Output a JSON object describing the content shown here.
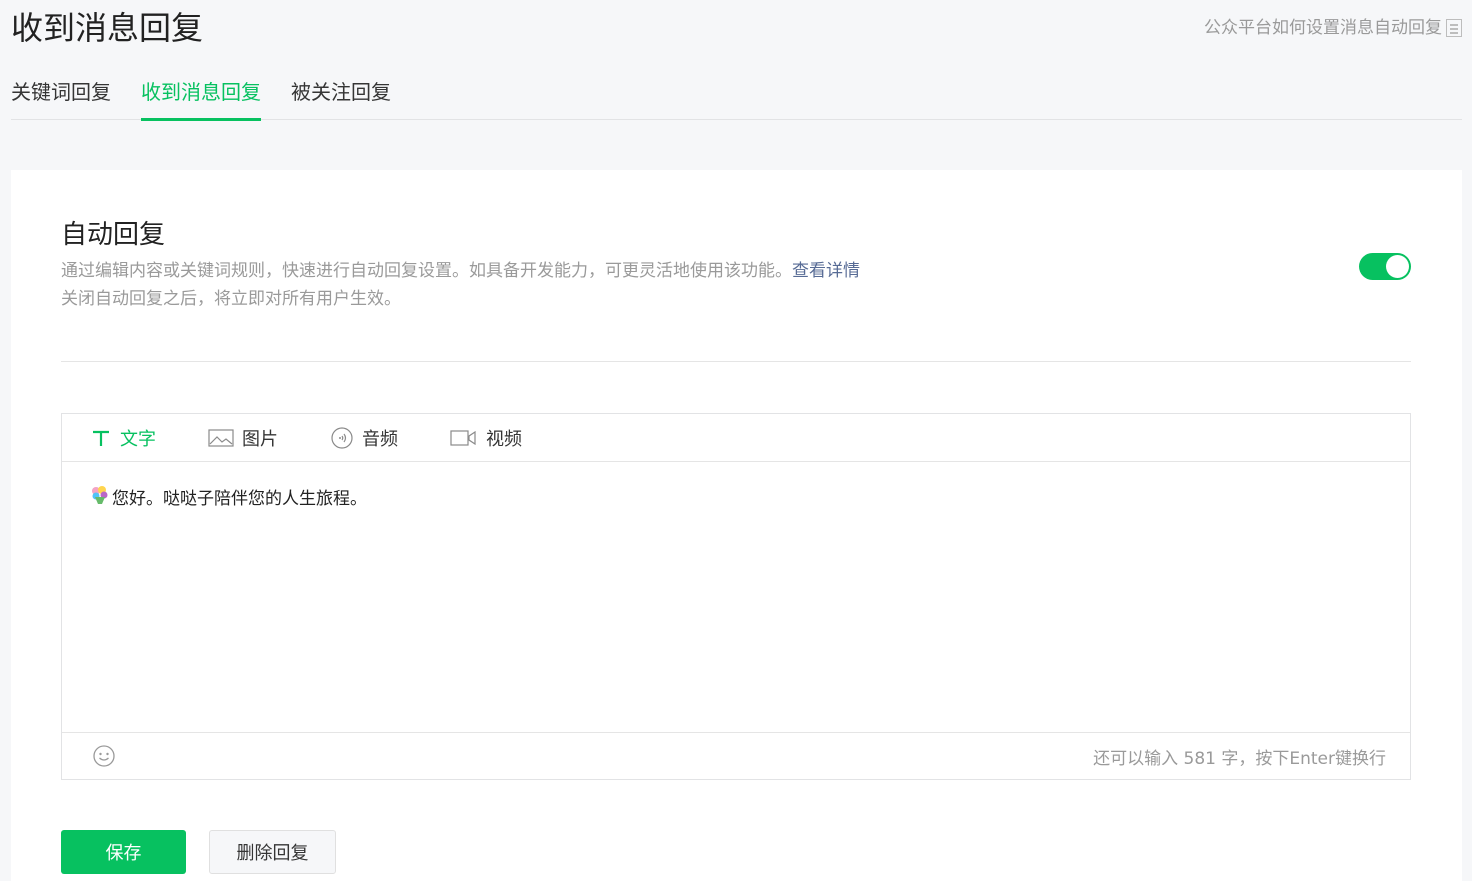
{
  "page": {
    "title": "收到消息回复",
    "help_link": "公众平台如何设置消息自动回复"
  },
  "tabs": [
    {
      "label": "关键词回复",
      "active": false
    },
    {
      "label": "收到消息回复",
      "active": true
    },
    {
      "label": "被关注回复",
      "active": false
    }
  ],
  "auto_reply": {
    "title": "自动回复",
    "description_line1": "通过编辑内容或关键词规则，快速进行自动回复设置。如具备开发能力，可更灵活地使用该功能。",
    "details_link": "查看详情",
    "description_line2": "关闭自动回复之后，将立即对所有用户生效。",
    "enabled": true
  },
  "editor": {
    "tabs": [
      {
        "label": "文字",
        "icon": "text-icon",
        "active": true
      },
      {
        "label": "图片",
        "icon": "image-icon",
        "active": false
      },
      {
        "label": "音频",
        "icon": "audio-icon",
        "active": false
      },
      {
        "label": "视频",
        "icon": "video-icon",
        "active": false
      }
    ],
    "content": "您好。哒哒子陪伴您的人生旅程。",
    "counter": "还可以输入 581 字，按下Enter键换行"
  },
  "actions": {
    "save_label": "保存",
    "delete_label": "删除回复"
  },
  "colors": {
    "accent": "#07c160",
    "link": "#576b95"
  }
}
